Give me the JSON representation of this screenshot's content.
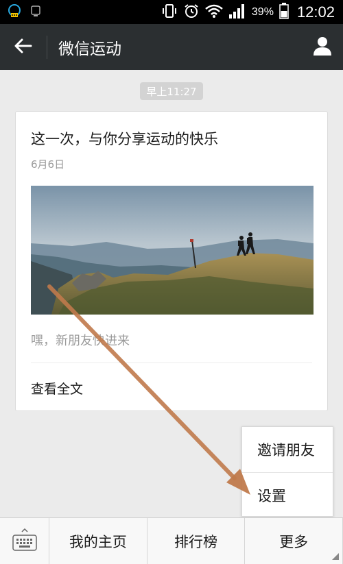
{
  "status_bar": {
    "battery_percent": "39%",
    "time": "12:02",
    "icons": [
      "wechat-notification-icon",
      "sync-icon",
      "vibrate-icon",
      "alarm-icon",
      "wifi-icon",
      "signal-icon",
      "battery-icon"
    ]
  },
  "header": {
    "title": "微信运动",
    "back_icon": "back-arrow-icon",
    "profile_icon": "person-icon"
  },
  "chat": {
    "timestamp": "早上11:27"
  },
  "card": {
    "title": "这一次，与你分享运动的快乐",
    "date": "6月6日",
    "description": "嘿，新朋友快进来",
    "read_more": "查看全文"
  },
  "popup_menu": {
    "items": [
      "邀请朋友",
      "设置"
    ]
  },
  "bottom_bar": {
    "keyboard_icon": "keyboard-icon",
    "tabs": [
      "我的主页",
      "排行榜",
      "更多"
    ]
  },
  "colors": {
    "header_bg": "#2b2f31",
    "page_bg": "#ebebeb",
    "arrow": "#c07a4c"
  }
}
